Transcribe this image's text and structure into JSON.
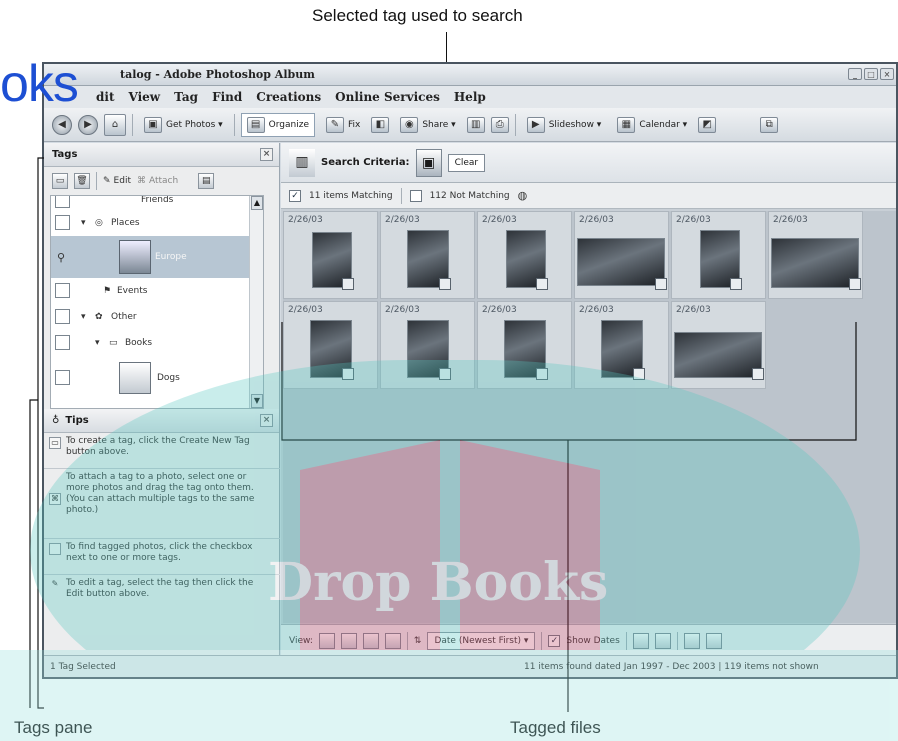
{
  "annotations": {
    "top": "Selected tag used to search",
    "bottom_left": "Tags pane",
    "bottom_center": "Tagged files"
  },
  "brand_text": "oks",
  "watermark_text": "Drop Books",
  "window": {
    "title": "My Catalog - Adobe Photoshop Album",
    "title_visible": "talog - Adobe Photoshop Album"
  },
  "menu": [
    {
      "label": "dit"
    },
    {
      "label": "View"
    },
    {
      "label": "Tag"
    },
    {
      "label": "Find"
    },
    {
      "label": "Creations"
    },
    {
      "label": "Online Services"
    },
    {
      "label": "Help"
    }
  ],
  "toolbar": {
    "get_photos": "Get Photos ▾",
    "organize": "Organize",
    "fix": "Fix",
    "share": "Share ▾",
    "slideshow": "Slideshow ▾",
    "calendar": "Calendar ▾"
  },
  "tags_pane": {
    "title": "Tags",
    "edit": "Edit",
    "attach": "Attach",
    "rows": [
      {
        "label": "Friends"
      },
      {
        "label": "Places"
      },
      {
        "label": "Europe"
      },
      {
        "label": "Events"
      },
      {
        "label": "Other"
      },
      {
        "label": "Books"
      },
      {
        "label": "Dogs"
      }
    ]
  },
  "tips": {
    "title": "Tips",
    "items": [
      "To create a tag, click the Create New Tag button above.",
      "To attach a tag to a photo, select one or more photos and drag the tag onto them. (You can attach multiple tags to the same photo.)",
      "To find tagged photos, click the checkbox next to one or more tags.",
      "To edit a tag, select the tag then click the Edit button above."
    ]
  },
  "search": {
    "label": "Search Criteria:",
    "clear": "Clear",
    "matching": "11 items Matching",
    "not_matching": "112 Not Matching"
  },
  "photos": [
    {
      "date": "2/26/03"
    },
    {
      "date": "2/26/03"
    },
    {
      "date": "2/26/03"
    },
    {
      "date": "2/26/03"
    },
    {
      "date": "2/26/03"
    },
    {
      "date": "2/26/03"
    },
    {
      "date": "2/26/03"
    },
    {
      "date": "2/26/03"
    },
    {
      "date": "2/26/03"
    },
    {
      "date": "2/26/03"
    },
    {
      "date": "2/26/03"
    }
  ],
  "view_bar": {
    "view_label": "View:",
    "sort": "Date (Newest First) ▾",
    "show_dates": "Show Dates"
  },
  "status": {
    "left": "1 Tag Selected",
    "right": "11 items found dated Jan 1997 - Dec 2003  |  119 items not shown"
  }
}
